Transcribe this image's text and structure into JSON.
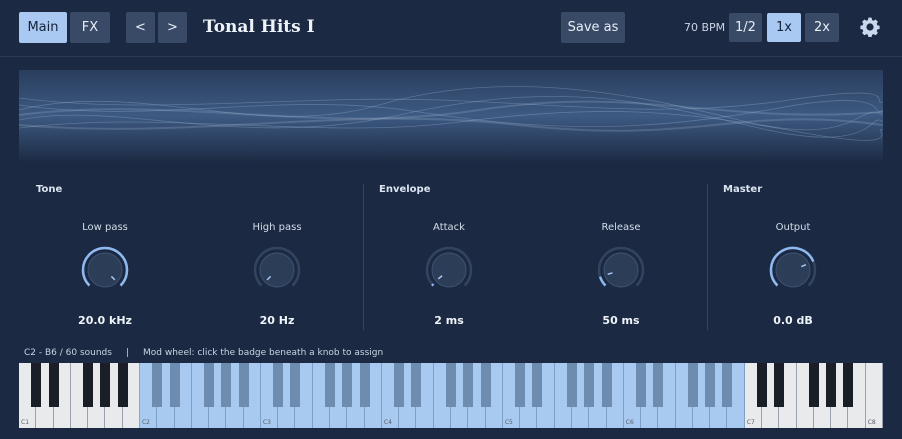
{
  "toolbar": {
    "main_label": "Main",
    "fx_label": "FX",
    "prev_label": "<",
    "next_label": ">",
    "preset_name": "Tonal Hits I",
    "save_as_label": "Save as",
    "bpm_label": "70 BPM",
    "speed_options": [
      "1/2",
      "1x",
      "2x"
    ],
    "speed_selected": "1x",
    "settings_icon": "gear-icon"
  },
  "sections": {
    "tone": "Tone",
    "envelope": "Envelope",
    "master": "Master"
  },
  "knobs": [
    {
      "label": "Low pass",
      "value": "20.0 kHz",
      "level": 1.0
    },
    {
      "label": "High pass",
      "value": "20 Hz",
      "level": 0.0
    },
    {
      "label": "Attack",
      "value": "2 ms",
      "level": 0.02
    },
    {
      "label": "Release",
      "value": "50 ms",
      "level": 0.1
    },
    {
      "label": "Output",
      "value": "0.0 dB",
      "level": 0.75
    }
  ],
  "status": {
    "range": "C2 - B6  /  60 sounds",
    "separator": "|",
    "hint": "Mod wheel: click the badge beneath a knob to assign"
  },
  "keyboard": {
    "octave_labels": [
      "C1",
      "C2",
      "C3",
      "C4",
      "C5",
      "C6",
      "C7",
      "C8"
    ],
    "range_start": "C2",
    "range_end": "B6"
  },
  "colors": {
    "background": "#1b2942",
    "accent": "#a9c9f3",
    "key_highlight": "#a8caf0"
  }
}
